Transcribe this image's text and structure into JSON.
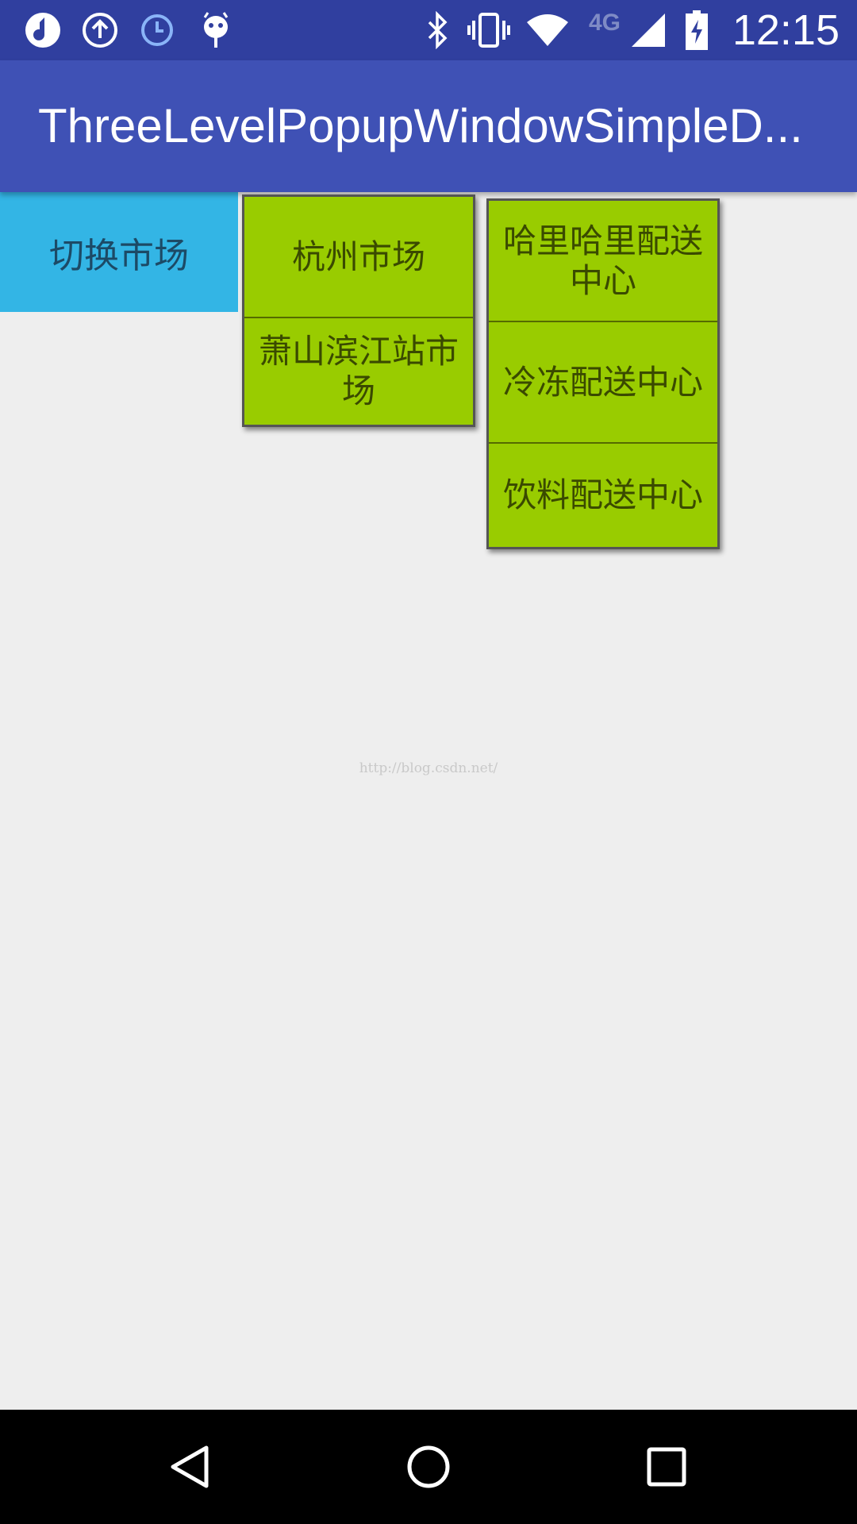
{
  "status_bar": {
    "time": "12:15",
    "network_label": "4G",
    "left_icons": [
      "music-note-icon",
      "upload-icon",
      "clock-icon",
      "android-icon"
    ],
    "right_icons": [
      "bluetooth-icon",
      "vibrate-icon",
      "wifi-icon",
      "signal-icon",
      "battery-charging-icon"
    ]
  },
  "app_bar": {
    "title": "ThreeLevelPopupWindowSimpleD..."
  },
  "switch_button": {
    "label": "切换市场"
  },
  "popup_level_2": {
    "items": [
      {
        "label": "杭州市场"
      },
      {
        "label": "萧山滨江站市场"
      }
    ]
  },
  "popup_level_3": {
    "items": [
      {
        "label": "哈里哈里配送中心"
      },
      {
        "label": "冷冻配送中心"
      },
      {
        "label": "饮料配送中心"
      }
    ]
  },
  "watermark": "http://blog.csdn.net/",
  "nav_bar": {
    "buttons": [
      "back-icon",
      "home-icon",
      "recents-icon"
    ]
  },
  "colors": {
    "status_bar": "#303f9f",
    "app_bar": "#3f51b5",
    "switch_button": "#33b5e5",
    "popup_background": "#99cc00",
    "page_background": "#eeeeee"
  }
}
